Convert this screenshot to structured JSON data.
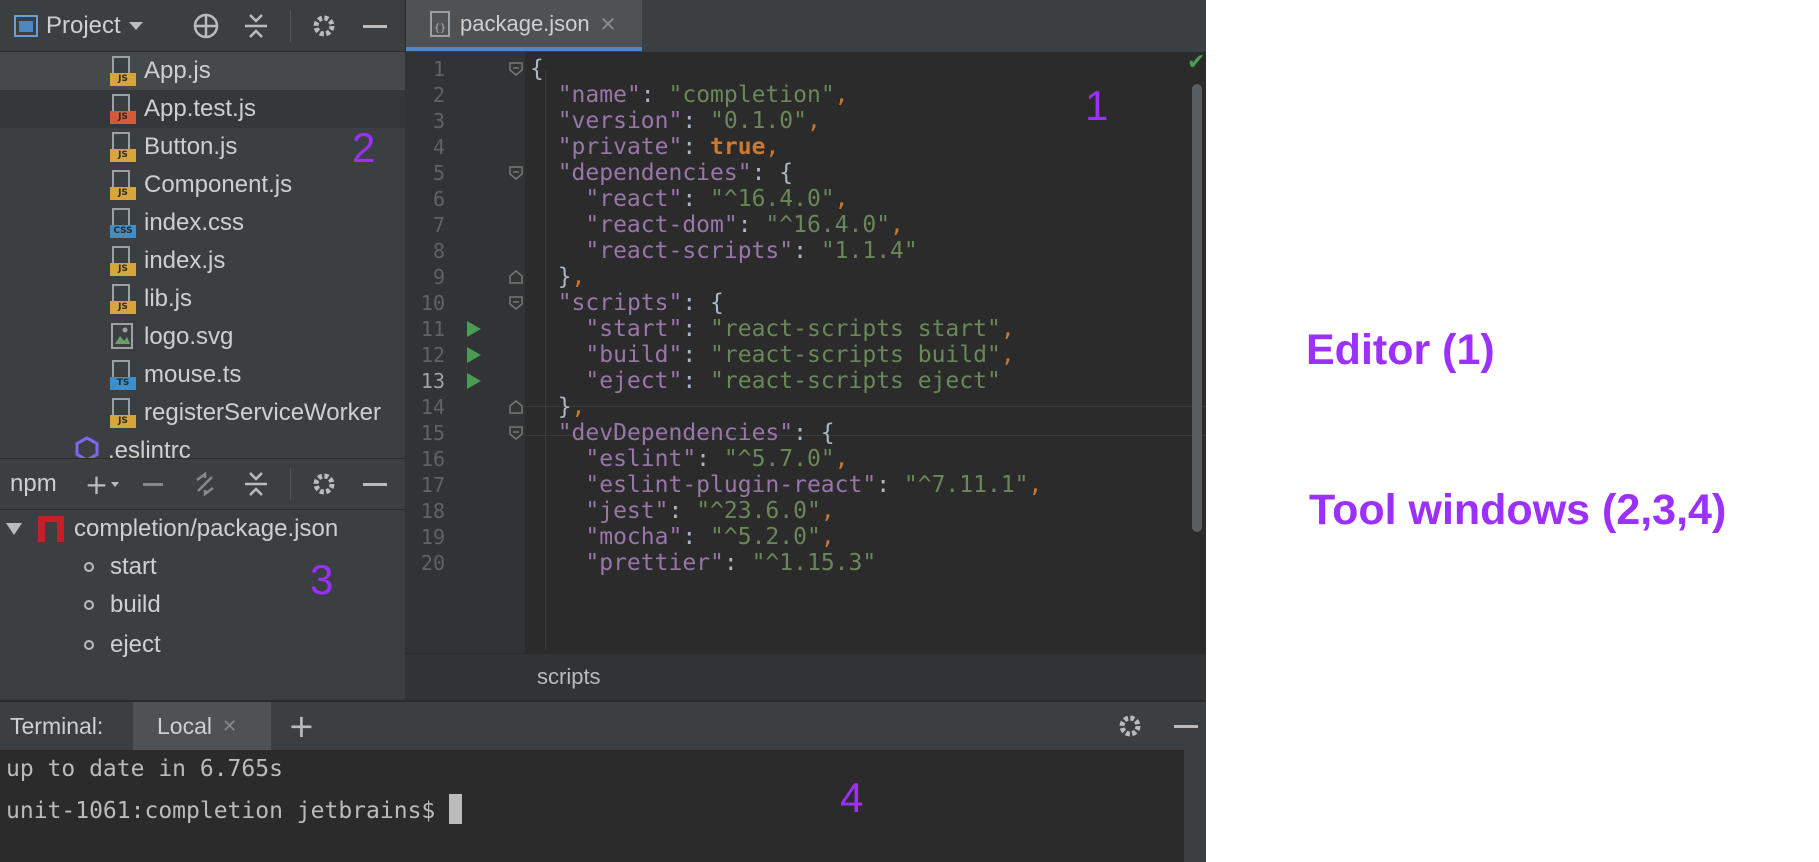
{
  "project_panel": {
    "title": "Project",
    "files": [
      {
        "name": "App.js",
        "type": "JS"
      },
      {
        "name": "App.test.js",
        "type": "JS"
      },
      {
        "name": "Button.js",
        "type": "JS"
      },
      {
        "name": "Component.js",
        "type": "JS"
      },
      {
        "name": "index.css",
        "type": "CSS"
      },
      {
        "name": "index.js",
        "type": "JS"
      },
      {
        "name": "lib.js",
        "type": "JS"
      },
      {
        "name": "logo.svg",
        "type": "SVG"
      },
      {
        "name": "mouse.ts",
        "type": "TS"
      },
      {
        "name": "registerServiceWorker",
        "type": "JS"
      },
      {
        "name": ".eslintrc",
        "type": "ESLINT"
      }
    ],
    "badges": {
      "js": "JS",
      "css": "CSS",
      "ts": "TS"
    }
  },
  "npm_panel": {
    "title": "npm",
    "root": "completion/package.json",
    "scripts": [
      "start",
      "build",
      "eject"
    ]
  },
  "editor": {
    "tab_label": "package.json",
    "breadcrumb": "scripts",
    "current_line": 13,
    "lines": [
      {
        "n": "1"
      },
      {
        "n": "2"
      },
      {
        "n": "3"
      },
      {
        "n": "4"
      },
      {
        "n": "5"
      },
      {
        "n": "6"
      },
      {
        "n": "7"
      },
      {
        "n": "8"
      },
      {
        "n": "9"
      },
      {
        "n": "10"
      },
      {
        "n": "11"
      },
      {
        "n": "12"
      },
      {
        "n": "13"
      },
      {
        "n": "14"
      },
      {
        "n": "15"
      },
      {
        "n": "16"
      },
      {
        "n": "17"
      },
      {
        "n": "18"
      },
      {
        "n": "19"
      },
      {
        "n": "20"
      }
    ],
    "tokens": {
      "name_key": "\"name\"",
      "name_val": "\"completion\"",
      "version_key": "\"version\"",
      "version_val": "\"0.1.0\"",
      "private_key": "\"private\"",
      "private_val": "true",
      "dependencies_key": "\"dependencies\"",
      "react_key": "\"react\"",
      "react_val": "\"^16.4.0\"",
      "react_dom_key": "\"react-dom\"",
      "react_dom_val": "\"^16.4.0\"",
      "react_scripts_key": "\"react-scripts\"",
      "react_scripts_val": "\"1.1.4\"",
      "scripts_key": "\"scripts\"",
      "start_key": "\"start\"",
      "start_val": "\"react-scripts start\"",
      "build_key": "\"build\"",
      "build_val": "\"react-scripts build\"",
      "eject_key": "\"eject\"",
      "eject_val": "\"react-scripts eject\"",
      "devDependencies_key": "\"devDependencies\"",
      "eslint_key": "\"eslint\"",
      "eslint_val": "\"^5.7.0\"",
      "eslint_plugin_key": "\"eslint-plugin-react\"",
      "eslint_plugin_val": "\"^7.11.1\"",
      "jest_key": "\"jest\"",
      "jest_val": "\"^23.6.0\"",
      "mocha_key": "\"mocha\"",
      "mocha_val": "\"^5.2.0\"",
      "prettier_key": "\"prettier\"",
      "prettier_val": "\"^1.15.3\""
    }
  },
  "terminal": {
    "title": "Terminal:",
    "tab_label": "Local",
    "lines": [
      "up to date in 6.765s",
      "unit-1061:completion jetbrains$ "
    ]
  },
  "annotations": {
    "a1": "1",
    "a2": "2",
    "a3": "3",
    "a4": "4",
    "editor_label": "Editor (1)",
    "tool_windows_label": "Tool windows (2,3,4)"
  },
  "colors": {
    "accent": "#9b30ff",
    "ide_bg": "#3c3f41",
    "editor_bg": "#2b2b2b",
    "keyword": "#9876aa",
    "string": "#6a8759",
    "punct": "#cc7832",
    "run_green": "#499c54"
  }
}
